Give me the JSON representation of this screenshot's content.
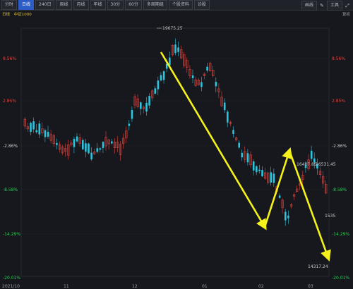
{
  "toolbar": {
    "buttons": [
      {
        "label": "分时",
        "active": false
      },
      {
        "label": "日线",
        "active": true
      },
      {
        "label": "240日",
        "active": false
      },
      {
        "label": "周线",
        "active": false
      },
      {
        "label": "月线",
        "active": false
      },
      {
        "label": "年线",
        "active": false
      },
      {
        "label": "30分",
        "active": false
      },
      {
        "label": "60分",
        "active": false
      },
      {
        "label": "多周期组",
        "active": false
      },
      {
        "label": "个股资料",
        "active": false
      },
      {
        "label": "诊股",
        "active": false
      }
    ],
    "right": {
      "draw_label": "画线",
      "tools_label": "工具"
    }
  },
  "subbar": {
    "tag": "日线",
    "name": "中证1000",
    "right": "复权"
  },
  "chart_data": {
    "type": "candlestick",
    "y_axis_left": [
      "8.56%",
      "2.85%",
      "-2.86%",
      "-8.58%",
      "-14.29%",
      "-20.01%"
    ],
    "y_axis_right": [
      "8.56%",
      "2.85%",
      "-2.86%",
      "-8.58%",
      "-14.29%",
      "-20.01%"
    ],
    "x_labels": [
      "2021/10",
      "11",
      "12",
      "01",
      "02",
      "03"
    ],
    "annotations": [
      "19675.25",
      "16407.85",
      "16531.45",
      "1535",
      "14317.24"
    ],
    "colors": {
      "up": "#e0443e",
      "down": "#2ec4dd",
      "arrow": "#f4f11b",
      "grid": "#2a2d33",
      "pos_axis": "#e0443e",
      "neg_axis": "#34c759"
    }
  }
}
